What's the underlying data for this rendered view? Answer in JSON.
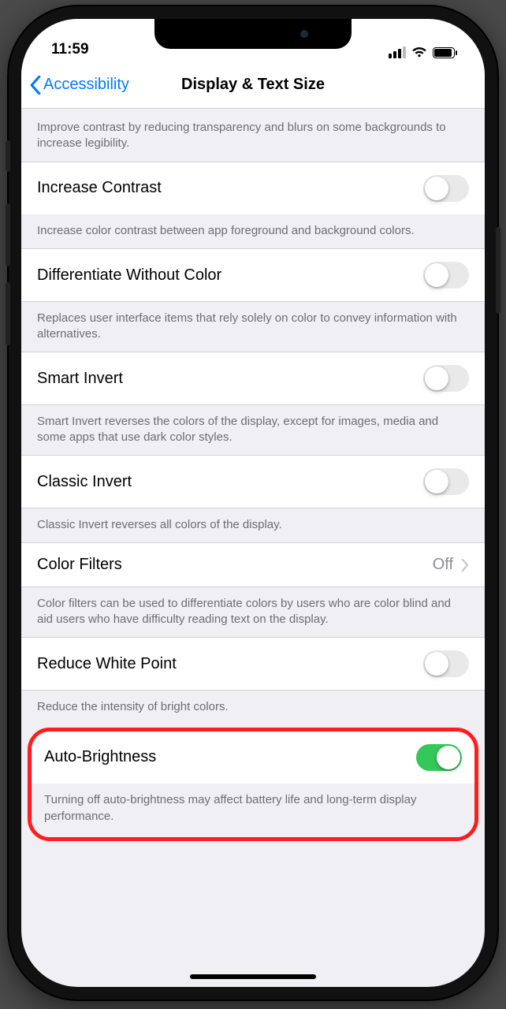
{
  "status": {
    "time": "11:59"
  },
  "nav": {
    "back_label": "Accessibility",
    "title": "Display & Text Size"
  },
  "rows": {
    "transparency": {
      "footer": "Improve contrast by reducing transparency and blurs on some backgrounds to increase legibility."
    },
    "increase_contrast": {
      "label": "Increase Contrast",
      "on": false,
      "footer": "Increase color contrast between app foreground and background colors."
    },
    "differentiate": {
      "label": "Differentiate Without Color",
      "on": false,
      "footer": "Replaces user interface items that rely solely on color to convey information with alternatives."
    },
    "smart_invert": {
      "label": "Smart Invert",
      "on": false,
      "footer": "Smart Invert reverses the colors of the display, except for images, media and some apps that use dark color styles."
    },
    "classic_invert": {
      "label": "Classic Invert",
      "on": false,
      "footer": "Classic Invert reverses all colors of the display."
    },
    "color_filters": {
      "label": "Color Filters",
      "value": "Off",
      "footer": "Color filters can be used to differentiate colors by users who are color blind and aid users who have difficulty reading text on the display."
    },
    "reduce_white_point": {
      "label": "Reduce White Point",
      "on": false,
      "footer": "Reduce the intensity of bright colors."
    },
    "auto_brightness": {
      "label": "Auto-Brightness",
      "on": true,
      "footer": "Turning off auto-brightness may affect battery life and long-term display performance."
    }
  },
  "colors": {
    "accent": "#007aff",
    "switch_on": "#34c759",
    "highlight": "#ff1e1e"
  }
}
